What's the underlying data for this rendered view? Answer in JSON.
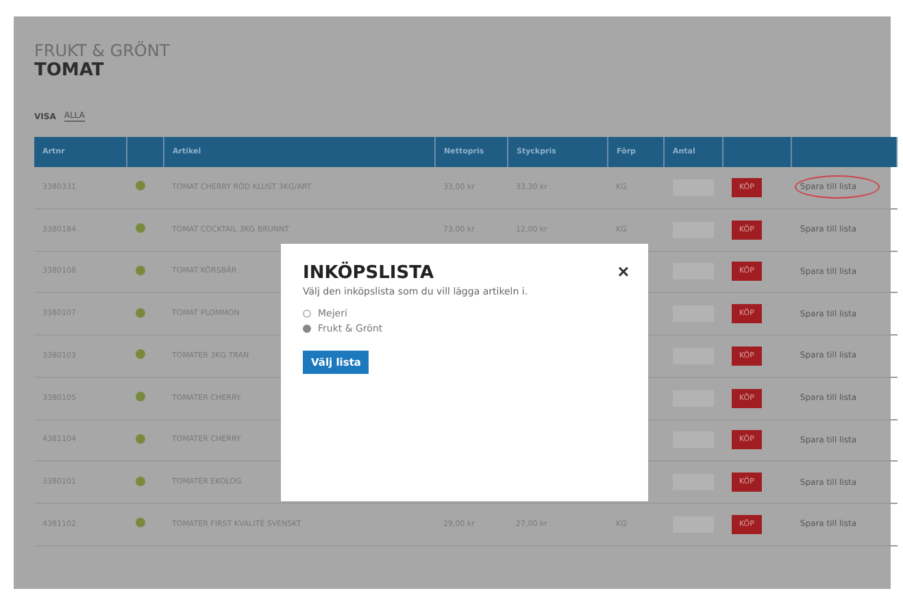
{
  "breadcrumb": "FRUKT & GRÖNT",
  "title": "TOMAT",
  "view": {
    "label": "VISA",
    "value": "ALLA"
  },
  "table": {
    "columns": [
      "Artnr",
      "",
      "Artikel",
      "Nettopris",
      "Styckpris",
      "Förp",
      "Antal"
    ],
    "rows": [
      {
        "artnr": "3380331",
        "name": "TOMAT CHERRY RÖD KLUST 3KG/ART",
        "net": "33,00 kr",
        "unit": "33,30 kr",
        "pack": "KG",
        "buy": "KÖP",
        "save": "Spara till lista",
        "marked": true
      },
      {
        "artnr": "3380184",
        "name": "TOMAT COCKTAIL 3KG BRUNNT",
        "net": "73,00 kr",
        "unit": "12,00 kr",
        "pack": "KG",
        "buy": "KÖP",
        "save": "Spara till lista",
        "marked": false
      },
      {
        "artnr": "3380108",
        "name": "TOMAT KÖRSBÄR",
        "net": "",
        "unit": "",
        "pack": "",
        "buy": "KÖP",
        "save": "Spara till lista",
        "marked": false
      },
      {
        "artnr": "3380107",
        "name": "TOMAT PLOMMON",
        "net": "",
        "unit": "",
        "pack": "",
        "buy": "KÖP",
        "save": "Spara till lista",
        "marked": false
      },
      {
        "artnr": "3380103",
        "name": "TOMATER 3KG TRAN",
        "net": "",
        "unit": "",
        "pack": "",
        "buy": "KÖP",
        "save": "Spara till lista",
        "marked": false
      },
      {
        "artnr": "3380105",
        "name": "TOMATER CHERRY",
        "net": "",
        "unit": "",
        "pack": "",
        "buy": "KÖP",
        "save": "Spara till lista",
        "marked": false
      },
      {
        "artnr": "4381104",
        "name": "TOMATER CHERRY",
        "net": "",
        "unit": "",
        "pack": "",
        "buy": "KÖP",
        "save": "Spara till lista",
        "marked": false
      },
      {
        "artnr": "3380101",
        "name": "TOMATER EKOLOG",
        "net": "",
        "unit": "",
        "pack": "",
        "buy": "KÖP",
        "save": "Spara till lista",
        "marked": false
      },
      {
        "artnr": "4381102",
        "name": "TOMATER FIRST KVALITÉ SVENSKT",
        "net": "29,00 kr",
        "unit": "27,00 kr",
        "pack": "KG",
        "buy": "KÖP",
        "save": "Spara till lista",
        "marked": false
      }
    ]
  },
  "modal": {
    "title": "INKÖPSLISTA",
    "description": "Välj den inköpslista som du vill lägga artikeln i.",
    "close": "×",
    "options": [
      {
        "label": "Mejeri",
        "selected": false
      },
      {
        "label": "Frukt & Grönt",
        "selected": true
      }
    ],
    "button": "Välj lista"
  }
}
